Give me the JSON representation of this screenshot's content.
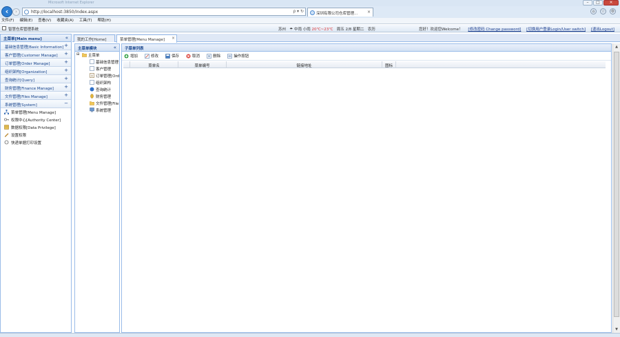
{
  "browser": {
    "window_title": "Microsoft Internet Explorer",
    "url": "http://localhost:3850/Index.aspx",
    "address_tools": "ρ ▾ ↻",
    "tab_label": "深圳有限公司仓库管理...",
    "tab_close": "×",
    "icons": [
      "home-icon",
      "star-icon",
      "gear-icon"
    ]
  },
  "menubar": {
    "items": [
      "文件(F)",
      "编辑(E)",
      "查看(V)",
      "收藏夹(A)",
      "工具(T)",
      "帮助(H)"
    ]
  },
  "appbar": {
    "system_name": "智慧仓库管理系统",
    "location": "苏州",
    "weather": "中雨",
    "temp_label": "小雨",
    "temp": "20℃~23℃",
    "date": "周五  2/8  星期二",
    "extra": "农历",
    "welcome": "您好！欢迎您Welcome！",
    "links": [
      "[修改密码 Change password]",
      "[切换用户登录Login/User switch]",
      "[退出Logout]"
    ]
  },
  "mainmenu": {
    "title": "主菜单[Main menu]",
    "collapse": "«",
    "sections": [
      {
        "label": "基础信息管理[Basic Information]",
        "sign": "+"
      },
      {
        "label": "客户管理[Customer Manage]",
        "sign": "+"
      },
      {
        "label": "订单管理[Order Manage]",
        "sign": "+"
      },
      {
        "label": "组织架构[Organization]",
        "sign": "+"
      },
      {
        "label": "查询统计[Query]",
        "sign": "+"
      },
      {
        "label": "财务管理[Finance Manage]",
        "sign": "+"
      },
      {
        "label": "文件管理[Files Manage]",
        "sign": "+"
      },
      {
        "label": "系统管理[System]",
        "sign": "−"
      }
    ],
    "system_items": [
      "菜单管理[Menu Manage]",
      "权限中心[Authority Center]",
      "数据权限[Data Privilege]",
      "设置权限",
      "快递单据打印设置"
    ]
  },
  "tabs": [
    {
      "label": "我的工作[Home]",
      "closable": false
    },
    {
      "label": "菜单管理[Menu Manage]",
      "closable": true,
      "close": "×"
    }
  ],
  "tree": {
    "title": "主菜单模块",
    "collapse": "«",
    "root": "主菜单",
    "nodes": [
      "基础信息管理",
      "客户管理",
      "订单管理[Ord",
      "组织架构",
      "查询统计",
      "财务管理",
      "文件管理[File",
      "系统管理"
    ]
  },
  "grid": {
    "title": "子菜单列表",
    "toolbar": [
      "增加",
      "修改",
      "保存",
      "取消",
      "删除",
      "操作按钮"
    ],
    "columns": [
      "菜单名",
      "菜单编号",
      "链接地址",
      "图标"
    ]
  }
}
